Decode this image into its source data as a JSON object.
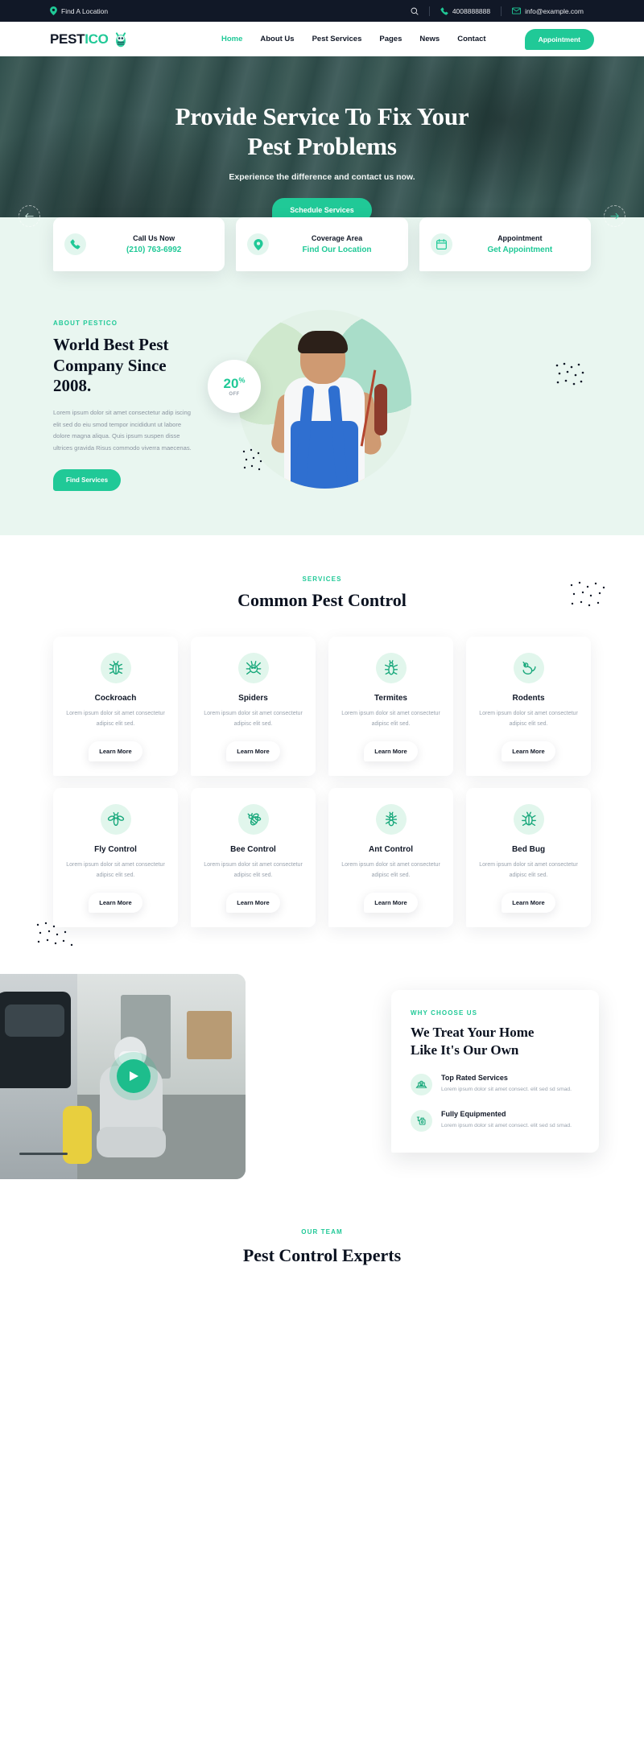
{
  "topbar": {
    "location": "Find A Location",
    "phone": "4008888888",
    "email": "info@example.com"
  },
  "header": {
    "logo_main": "PEST",
    "logo_accent": "ICO",
    "nav": [
      {
        "label": "Home",
        "active": true
      },
      {
        "label": "About Us",
        "active": false
      },
      {
        "label": "Pest Services",
        "active": false
      },
      {
        "label": "Pages",
        "active": false
      },
      {
        "label": "News",
        "active": false
      },
      {
        "label": "Contact",
        "active": false
      }
    ],
    "appointment_label": "Appointment"
  },
  "hero": {
    "title_line1": "Provide Service To Fix Your",
    "title_line2": "Pest Problems",
    "subtitle": "Experience the difference and contact us now.",
    "cta": "Schedule Services"
  },
  "info_cards": [
    {
      "icon": "phone-icon",
      "title": "Call Us Now",
      "value": "(210) 763-6992"
    },
    {
      "icon": "map-pin-icon",
      "title": "Coverage Area",
      "value": "Find Our Location"
    },
    {
      "icon": "calendar-icon",
      "title": "Appointment",
      "value": "Get Appointment"
    }
  ],
  "about": {
    "eyebrow": "ABOUT PESTICO",
    "heading": "World Best Pest Company Since 2008.",
    "paragraph": "Lorem ipsum dolor sit amet consectetur adip iscing elit sed do eiu smod tempor incididunt ut labore dolore magna aliqua. Quis ipsum suspen disse ultrices gravida Risus commodo viverra maecenas.",
    "button": "Find Services",
    "badge_number": "20",
    "badge_percent": "%",
    "badge_off": "OFF"
  },
  "services": {
    "eyebrow": "SERVICES",
    "heading": "Common Pest Control",
    "learn_more": "Learn More",
    "description": "Lorem ipsum dolor sit amet consectetur adipisc elit sed.",
    "items": [
      {
        "icon": "cockroach-icon",
        "title": "Cockroach"
      },
      {
        "icon": "spider-icon",
        "title": "Spiders"
      },
      {
        "icon": "termite-icon",
        "title": "Termites"
      },
      {
        "icon": "rodent-icon",
        "title": "Rodents"
      },
      {
        "icon": "fly-icon",
        "title": "Fly Control"
      },
      {
        "icon": "bee-icon",
        "title": "Bee Control"
      },
      {
        "icon": "ant-icon",
        "title": "Ant Control"
      },
      {
        "icon": "bedbug-icon",
        "title": "Bed Bug"
      }
    ]
  },
  "why": {
    "eyebrow": "WHY CHOOSE US",
    "heading_line1": "We Treat Your Home",
    "heading_line2": "Like It's Our Own",
    "features": [
      {
        "icon": "award-laptop-icon",
        "title": "Top Rated Services",
        "desc": "Lorem ipsum dolor sit amet consect. elit sed sd smad."
      },
      {
        "icon": "sprayer-icon",
        "title": "Fully Equipmented",
        "desc": "Lorem ipsum dolor sit amet consect. elit sed sd smad."
      }
    ]
  },
  "team": {
    "eyebrow": "OUR TEAM",
    "heading": "Pest Control Experts"
  },
  "colors": {
    "accent": "#20c997",
    "dark": "#111827",
    "mint_bg": "#e9f6f0"
  }
}
